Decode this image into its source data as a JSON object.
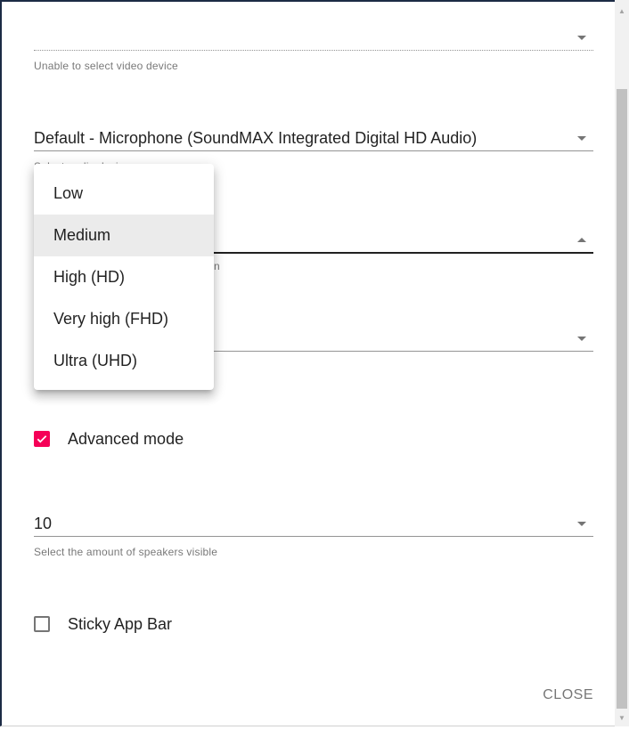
{
  "video_device": {
    "value": "",
    "helper": "Unable to select video device"
  },
  "audio_device": {
    "value": "Default - Microphone (SoundMAX Integrated Digital HD Audio)",
    "helper_partial": "Select audio device"
  },
  "quality": {
    "value": "",
    "helper_partial": "n",
    "options": [
      "Low",
      "Medium",
      "High (HD)",
      "Very high (FHD)",
      "Ultra (UHD)"
    ],
    "selected": "Medium"
  },
  "fourth_select": {
    "value": ""
  },
  "advanced_mode": {
    "label": "Advanced mode",
    "checked": true
  },
  "speakers": {
    "value": "10",
    "helper": "Select the amount of speakers visible"
  },
  "sticky_app_bar": {
    "label": "Sticky App Bar",
    "checked": false
  },
  "actions": {
    "close_label": "CLOSE"
  },
  "colors": {
    "accent": "#f50057",
    "frame_border": "#1c2b45"
  }
}
